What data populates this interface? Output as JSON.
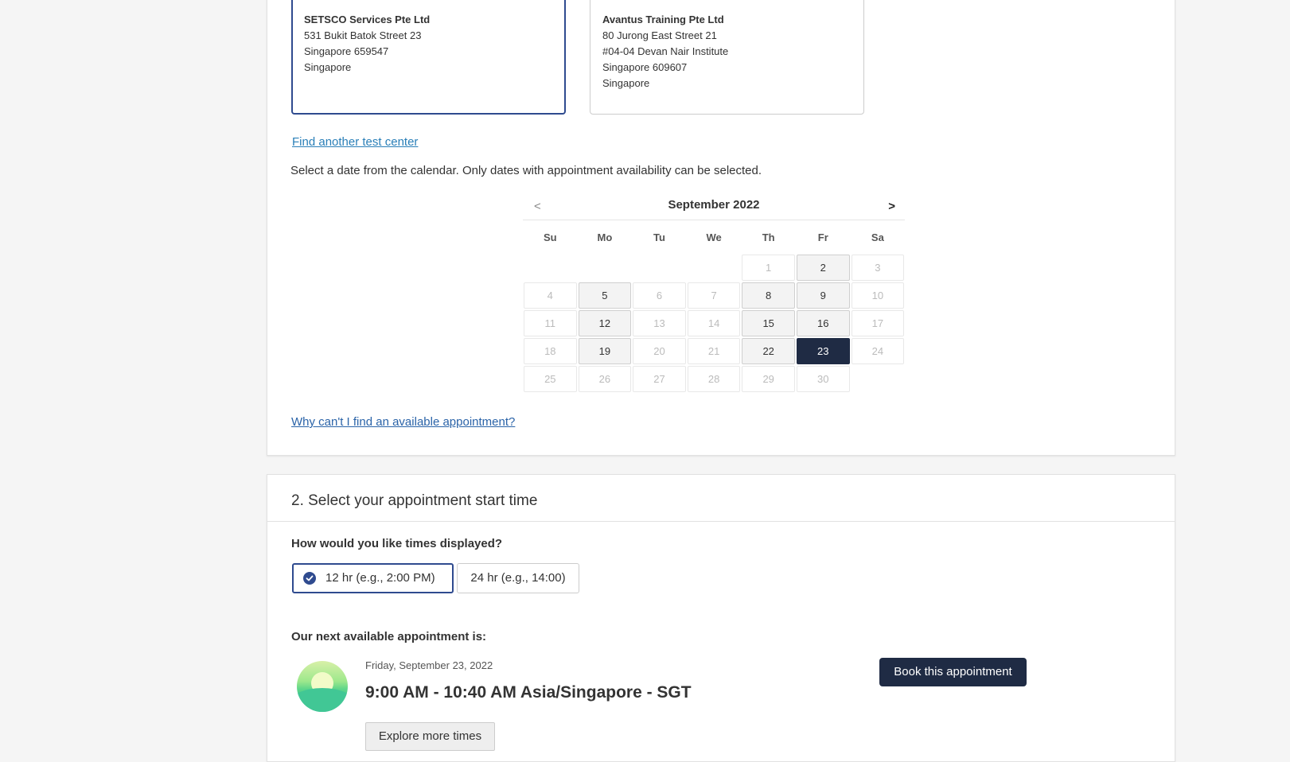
{
  "test_centers": [
    {
      "name": "SETSCO Services Pte Ltd",
      "lines": [
        "531 Bukit Batok Street 23",
        "Singapore 659547",
        "Singapore"
      ],
      "selected": true
    },
    {
      "name": "Avantus Training Pte Ltd",
      "lines": [
        "80 Jurong East Street 21",
        "#04-04 Devan Nair Institute",
        "Singapore 609607",
        "Singapore"
      ],
      "selected": false
    }
  ],
  "find_another_link": "Find another test center",
  "instruction": "Select a date from the calendar. Only dates with appointment availability can be selected.",
  "calendar": {
    "prev": "<",
    "next": ">",
    "month_title": "September 2022",
    "weekdays": [
      "Su",
      "Mo",
      "Tu",
      "We",
      "Th",
      "Fr",
      "Sa"
    ],
    "leading_blanks": 4,
    "days": [
      "1",
      "2",
      "3",
      "4",
      "5",
      "6",
      "7",
      "8",
      "9",
      "10",
      "11",
      "12",
      "13",
      "14",
      "15",
      "16",
      "17",
      "18",
      "19",
      "20",
      "21",
      "22",
      "23",
      "24",
      "25",
      "26",
      "27",
      "28",
      "29",
      "30"
    ],
    "available": [
      "2",
      "5",
      "8",
      "9",
      "12",
      "15",
      "16",
      "19",
      "22"
    ],
    "selected": "23"
  },
  "why_link": "Why can't I find an available appointment?",
  "section2": {
    "title": "2. Select your appointment start time",
    "question": "How would you like times displayed?",
    "format_12": "12 hr (e.g., 2:00 PM)",
    "format_24": "24 hr (e.g., 14:00)",
    "selected_format": "12",
    "next_available_label": "Our next available appointment is:",
    "appointment_date": "Friday, September 23, 2022",
    "appointment_time": "9:00 AM - 10:40 AM Asia/Singapore - SGT",
    "explore_button": "Explore more times",
    "book_button": "Book this appointment"
  },
  "colors": {
    "accent": "#2f4b8f",
    "dark_button": "#1f2b44",
    "link": "#2a63a8"
  }
}
